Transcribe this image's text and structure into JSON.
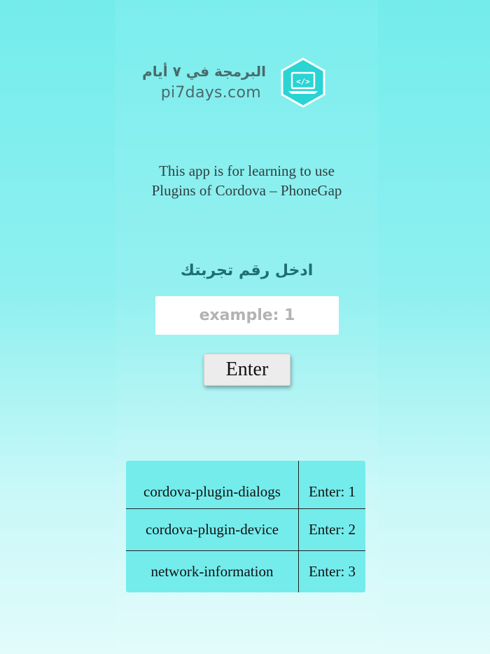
{
  "logo": {
    "arabic_name": "البرمجة في ٧ أيام",
    "domain": "pi7days.com",
    "icon": "code-laptop-hexagon-icon",
    "accent_color": "#2ad4d4"
  },
  "intro": {
    "line1": "This app is for learning to use",
    "line2": "Plugins of Cordova – PhoneGap"
  },
  "form": {
    "prompt": "ادخل رقم تجربتك",
    "input_placeholder": "example: 1",
    "input_value": "",
    "button_label": "Enter"
  },
  "plugins": [
    {
      "name": "cordova-plugin-dialogs",
      "key": "Enter: 1"
    },
    {
      "name": "cordova-plugin-device",
      "key": "Enter: 2"
    },
    {
      "name": "network-information",
      "key": "Enter: 3"
    }
  ],
  "colors": {
    "background_top": "#74ecec",
    "background_bottom": "#e2fbfb",
    "prompt_text": "#1f6e70"
  }
}
